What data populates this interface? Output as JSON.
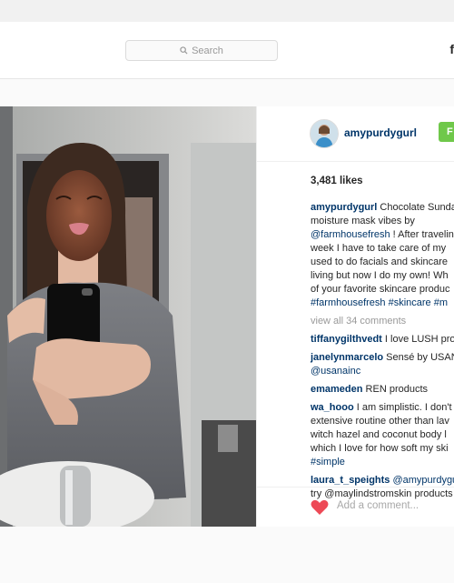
{
  "search": {
    "placeholder": "Search"
  },
  "nav": {
    "right_label": "f"
  },
  "post": {
    "username": "amypurdygurl",
    "follow_label": "F",
    "likes": "3,481 likes",
    "caption": {
      "user": "amypurdygurl",
      "line1": " Chocolate Sunda",
      "line2": "moisture mask vibes by",
      "line3_tag": "@farmhousefresh",
      "line3_rest": " ! After travelin",
      "line4": "week I have to take care of my",
      "line5": "used to do facials and skincare",
      "line6": "living but now I do my own! Wh",
      "line7": "of your favorite skincare produc",
      "line8_tags": "#farmhousefresh #skincare #m"
    },
    "view_all": "view all 34 comments",
    "comments": [
      {
        "user": "tiffanygilthvedt",
        "text": " I love LUSH pro"
      },
      {
        "user": "janelynmarcelo",
        "text": " Sensé by USAN",
        "line2_tag": "@usanainc"
      },
      {
        "user": "emameden",
        "text": " REN products"
      },
      {
        "user": "wa_hooo",
        "text": " I am simplistic. I don't",
        "line2": "extensive routine other than lav",
        "line3": "witch hazel and coconut body l",
        "line4": "which I love for how soft my ski",
        "line5_tag": "#simple"
      },
      {
        "user": "laura_t_speights",
        "text_tag": " @amypurdygu",
        "line2": "try @maylindstromskin products"
      }
    ],
    "add_comment_placeholder": "Add a comment..."
  },
  "colors": {
    "follow": "#6fc84a",
    "link": "#003569",
    "heart": "#ed4956"
  }
}
